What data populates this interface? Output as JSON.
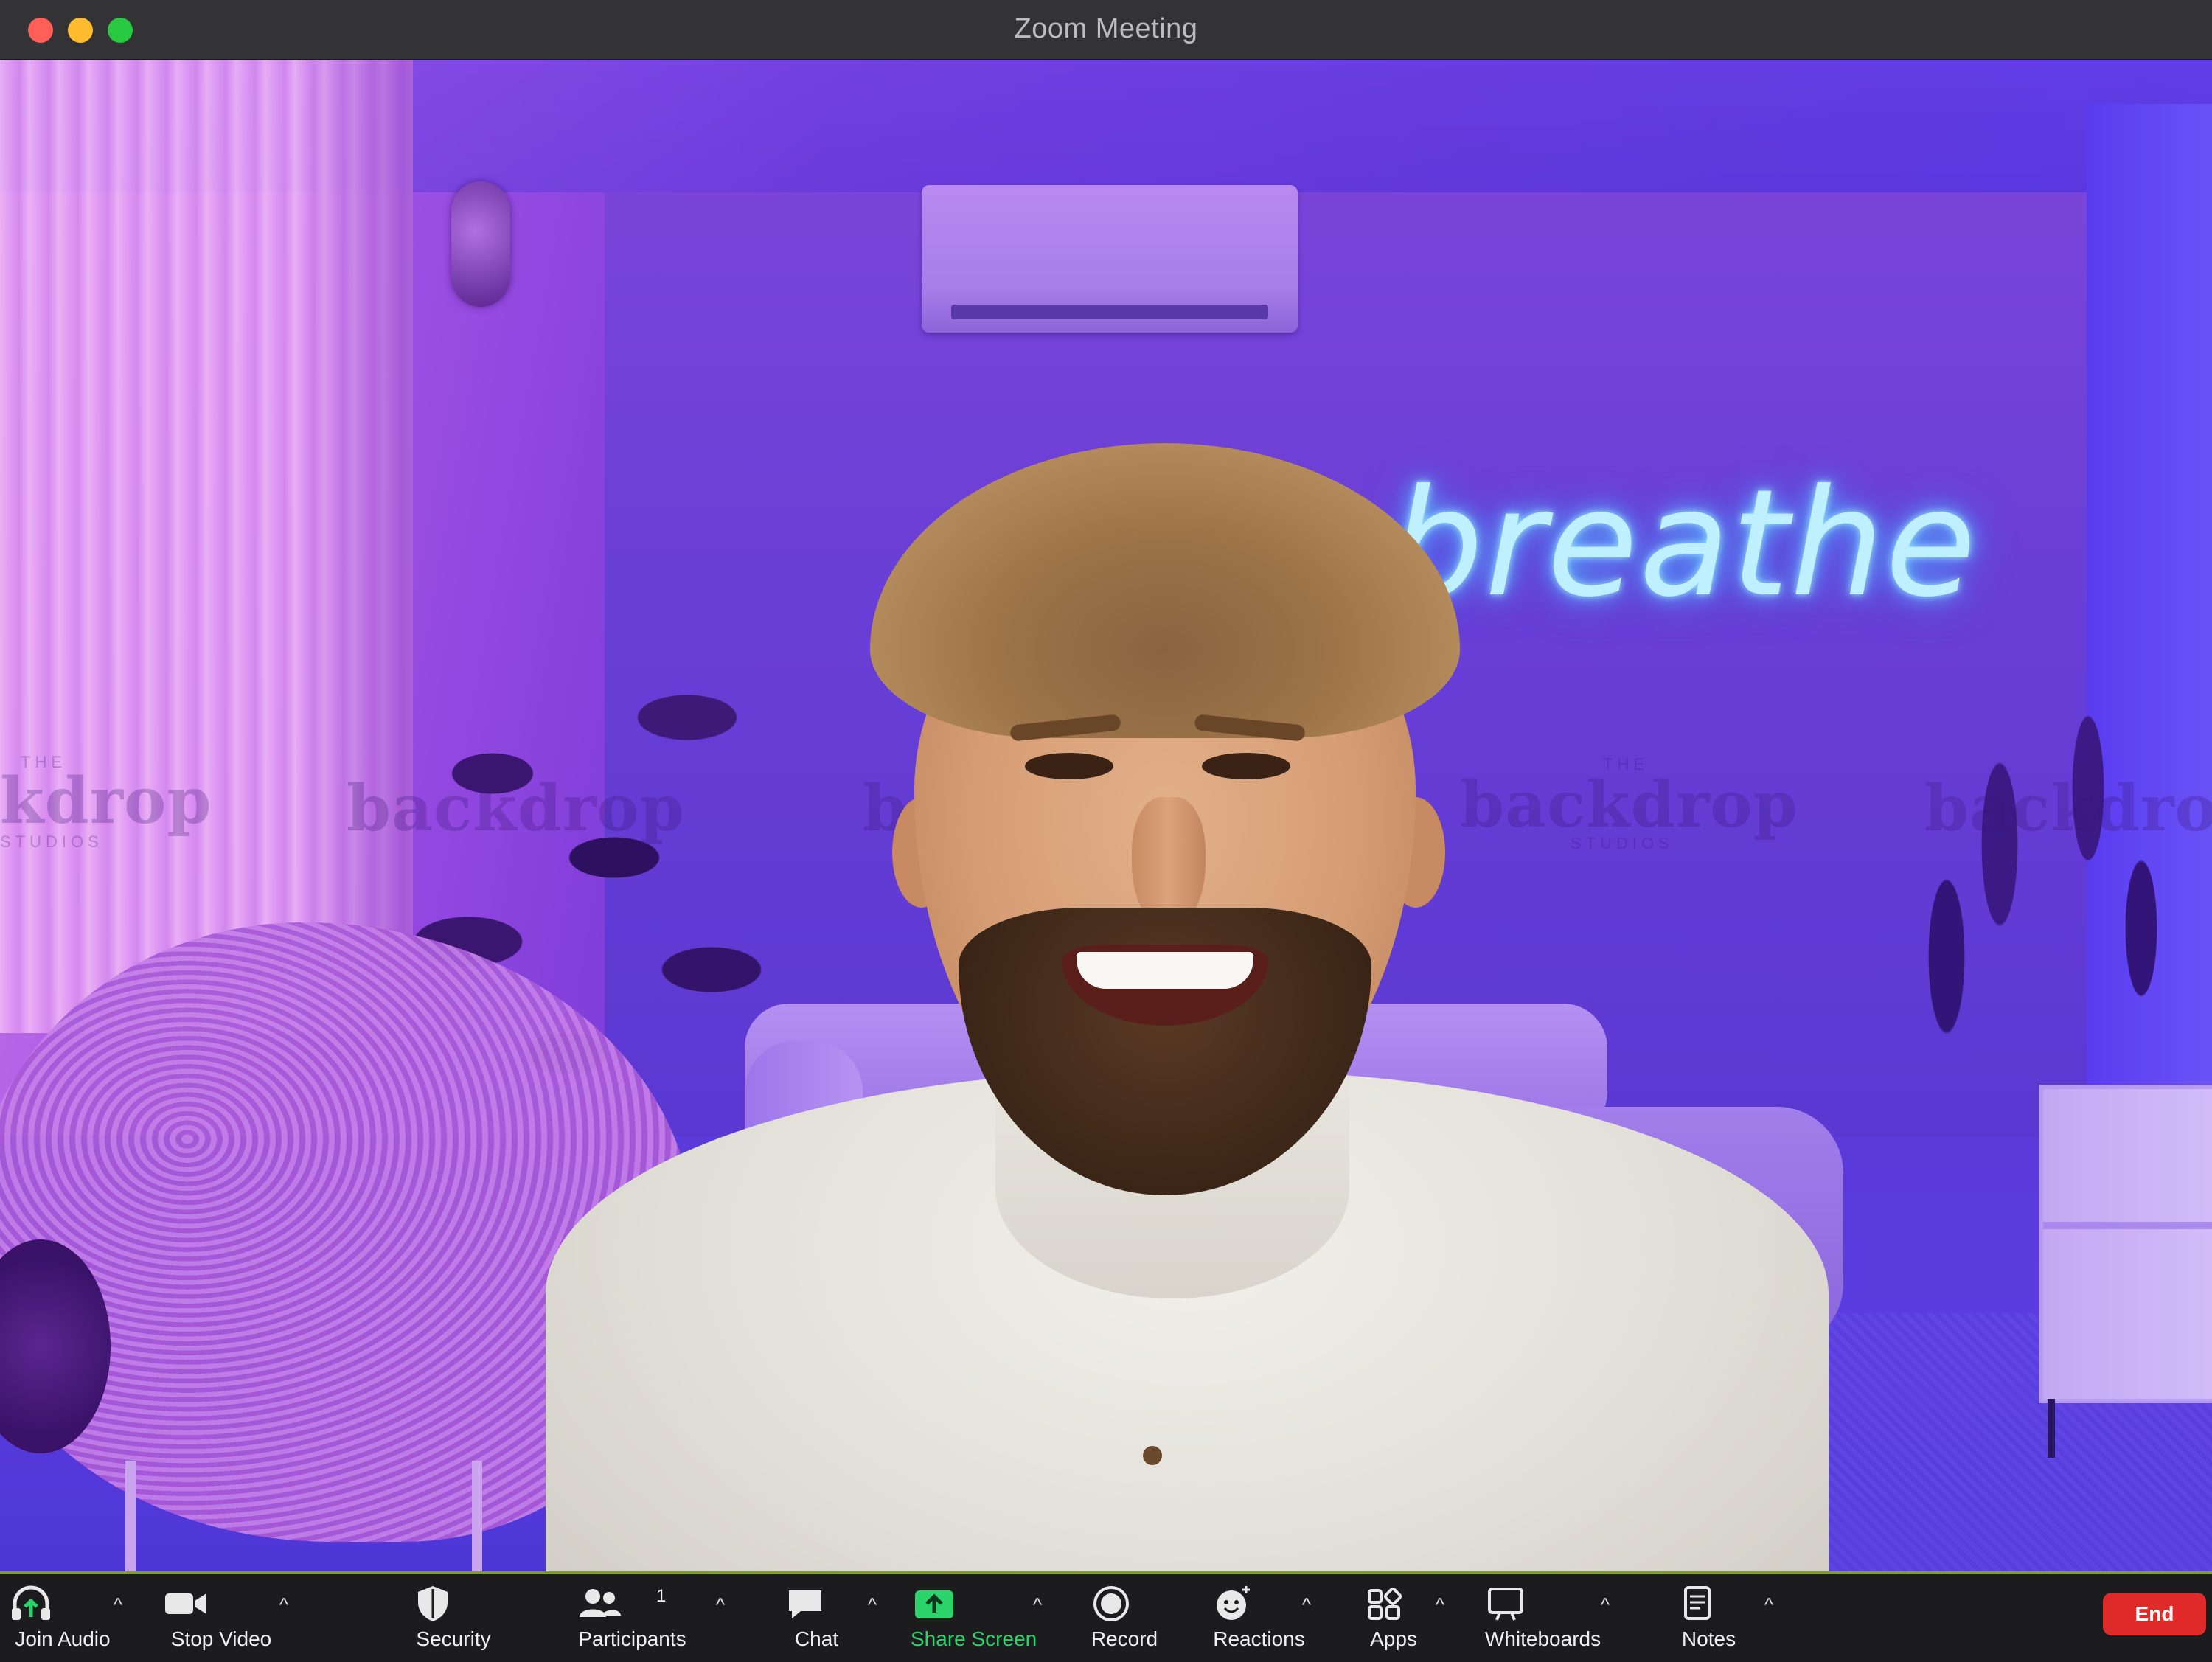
{
  "window": {
    "title": "Zoom Meeting"
  },
  "background": {
    "neon_sign": "breathe",
    "watermark_word": "backdrop",
    "watermark_word_cropped": "kdrop",
    "watermark_top": "THE",
    "watermark_bottom": "STUDIOS"
  },
  "toolbar": {
    "join_audio": "Join Audio",
    "stop_video": "Stop Video",
    "security": "Security",
    "participants": "Participants",
    "participants_count": "1",
    "chat": "Chat",
    "share_screen": "Share Screen",
    "record": "Record",
    "reactions": "Reactions",
    "apps": "Apps",
    "whiteboards": "Whiteboards",
    "notes": "Notes",
    "end": "End",
    "caret": "^"
  },
  "colors": {
    "share_screen_accent": "#2bd46a",
    "end_button": "#e02a2a",
    "toolbar_bg": "#1c1c1e"
  }
}
